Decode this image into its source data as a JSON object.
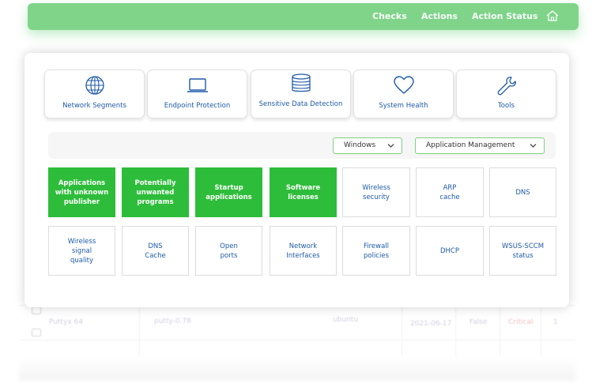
{
  "navbar": {
    "links": [
      "Checks",
      "Actions",
      "Action Status"
    ]
  },
  "background_table": {
    "row": {
      "name": "Puttyx 64",
      "package": "putty-0.78",
      "host": "ubuntu",
      "date": "2021-06-17",
      "flag": "False",
      "severity": "Critical",
      "count": "1"
    }
  },
  "categories": [
    {
      "label": "Network Segments",
      "icon": "globe-icon"
    },
    {
      "label": "Endpoint Protection",
      "icon": "laptop-icon"
    },
    {
      "label": "Sensitive Data Detection",
      "icon": "database-icon"
    },
    {
      "label": "System Health",
      "icon": "heart-icon"
    },
    {
      "label": "Tools",
      "icon": "wrench-icon"
    }
  ],
  "filters": {
    "os": "Windows",
    "area": "Application Management"
  },
  "tiles_row1": [
    {
      "label": "Applications\nwith unknown\npublisher",
      "active": true
    },
    {
      "label": "Potentially\nunwanted\nprograms",
      "active": true
    },
    {
      "label": "Startup\napplications",
      "active": true
    },
    {
      "label": "Software\nlicenses",
      "active": true
    },
    {
      "label": "Wireless\nsecurity",
      "active": false
    },
    {
      "label": "ARP\ncache",
      "active": false
    },
    {
      "label": "DNS",
      "active": false
    }
  ],
  "tiles_row2": [
    {
      "label": "Wireless\nsignal\nquality",
      "active": false
    },
    {
      "label": "DNS\nCache",
      "active": false
    },
    {
      "label": "Open\nports",
      "active": false
    },
    {
      "label": "Network\nInterfaces",
      "active": false
    },
    {
      "label": "Firewall\npolicies",
      "active": false
    },
    {
      "label": "DHCP",
      "active": false
    },
    {
      "label": "WSUS-SCCM\nstatus",
      "active": false
    }
  ],
  "colors": {
    "accent_green": "#2ebd3a",
    "navbar_green": "#7fd48a",
    "link_blue": "#1e5aa8"
  }
}
